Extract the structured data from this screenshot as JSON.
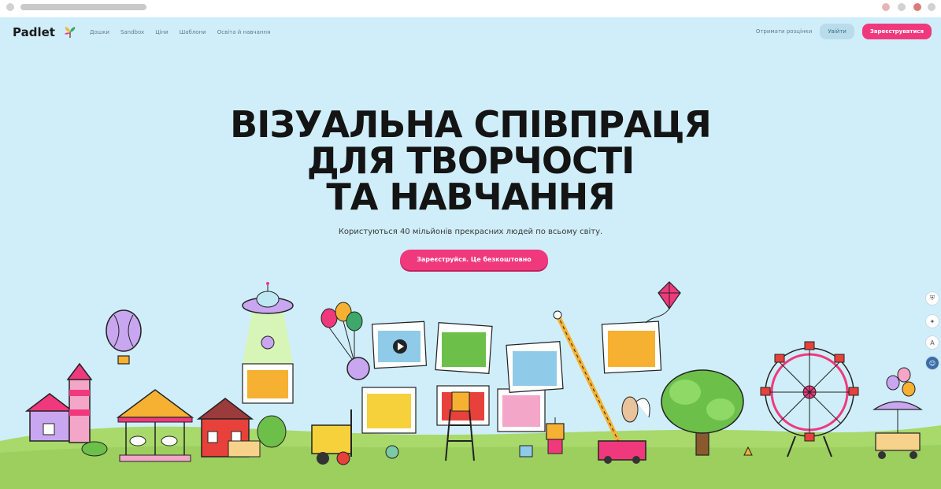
{
  "browser": {},
  "nav": {
    "logo": "Padlet",
    "links": [
      "Дошки",
      "Sandbox",
      "Ціни",
      "Шаблони",
      "Освіта й навчання"
    ],
    "edu": "Отримати розцінки",
    "login": "Увійти",
    "signup": "Зареєструватися"
  },
  "hero": {
    "title_lines": [
      "ВІЗУАЛЬНА СПІВПРАЦЯ",
      "ДЛЯ ТВОРЧОСТІ",
      "ТА НАВЧАННЯ"
    ],
    "subtitle": "Користуються 40 мільйонів прекрасних людей по всьому світу.",
    "cta": "Зареєструйся. Це безкоштовно"
  },
  "colors": {
    "sky": "#cfeefa",
    "accent": "#f0397c",
    "grass": "#a8d96a"
  },
  "side_icons": [
    "shield-icon",
    "bulb-icon",
    "translate-icon",
    "chat-icon"
  ]
}
